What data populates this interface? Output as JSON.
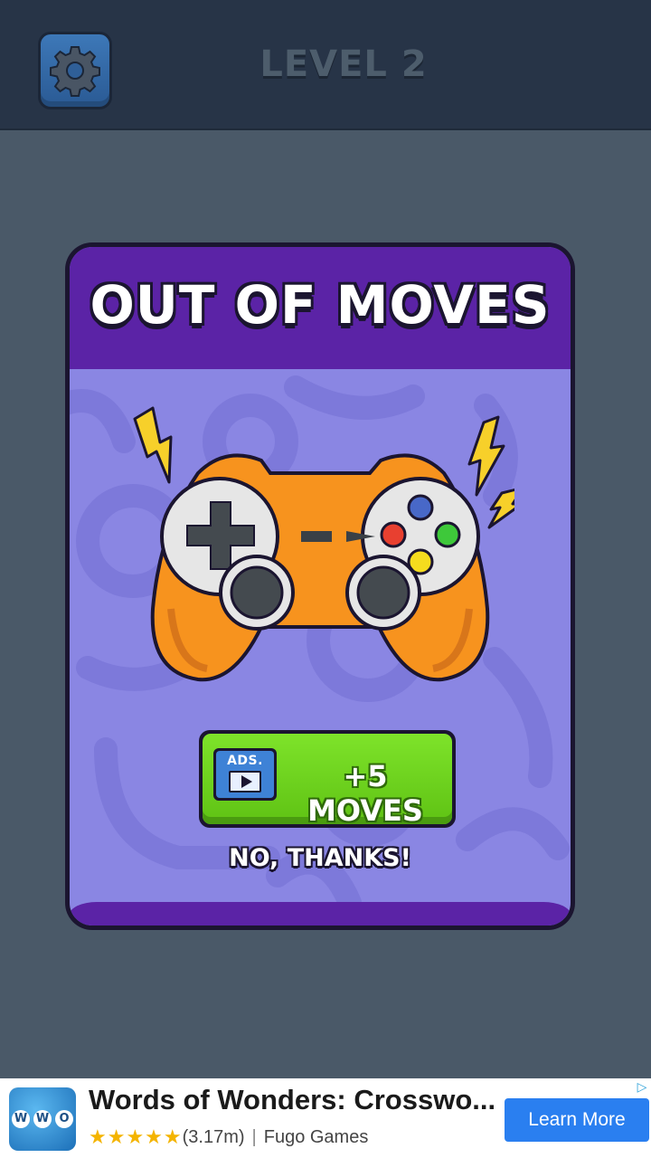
{
  "header": {
    "settings_icon": "gear-icon",
    "level_title": "LEVEL 2"
  },
  "modal": {
    "title": "OUT OF MOVES",
    "illustration": "gamepad-icon",
    "ads_button": {
      "icon_label": "ADS.",
      "label": "+5 MOVES"
    },
    "dismiss_label": "NO, THANKS!"
  },
  "ad_banner": {
    "app_name": "Words of Wonders: Crosswo...",
    "rating_stars": "★★★★★",
    "rating_count": "(3.17m)",
    "separator": "|",
    "publisher": "Fugo Games",
    "cta": "Learn More",
    "icon_letters": [
      "W",
      "W",
      "O"
    ]
  },
  "colors": {
    "background": "#4a5968",
    "topbar": "#273447",
    "modal_header": "#5b23a6",
    "modal_body": "#8a86e3",
    "cta_green": "#6fd21f",
    "controller_orange": "#f7931e",
    "ad_button_blue": "#2a7ff0"
  }
}
